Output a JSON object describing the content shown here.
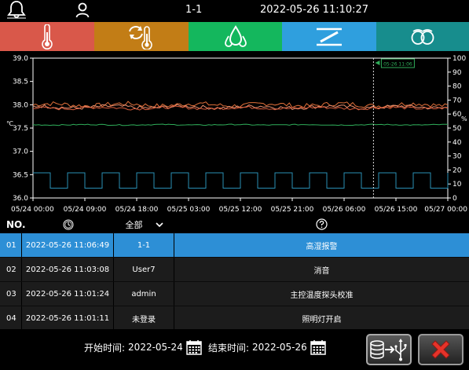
{
  "header": {
    "device_id": "1-1",
    "datetime": "2022-05-26 11:10:27"
  },
  "tabs": [
    {
      "name": "temperature",
      "color": "#d9584a",
      "width": 120
    },
    {
      "name": "temperature-cycle",
      "color": "#c27d16",
      "width": 120
    },
    {
      "name": "humidity",
      "color": "#14b75d",
      "width": 119
    },
    {
      "name": "ventilation",
      "color": "#2f9fde",
      "width": 120
    },
    {
      "name": "egg-turning",
      "color": "#178d8d",
      "width": 118
    }
  ],
  "chart_data": {
    "type": "line",
    "x": [
      "05/24 00:00",
      "05/24 09:00",
      "05/24 18:00",
      "05/25 03:00",
      "05/25 12:00",
      "05/25 21:00",
      "05/26 06:00",
      "05/26 15:00",
      "05/27 00:00"
    ],
    "left_axis": {
      "unit": "℃",
      "ylim": [
        36.0,
        39.0
      ],
      "ticks": [
        "39.0",
        "38.5",
        "38.0",
        "37.5",
        "37.0",
        "36.5",
        "36.0"
      ]
    },
    "right_axis": {
      "unit": "%",
      "ylim": [
        0,
        100
      ],
      "ticks": [
        "100",
        "90",
        "80",
        "70",
        "60",
        "50",
        "40",
        "30",
        "20",
        "10",
        "0"
      ]
    },
    "cursor_label": "05-26 11:06",
    "cursor_x": "05/26 11:06",
    "series": [
      {
        "color": "#e2703a",
        "axis": "left",
        "level": 38.0,
        "noise": 0.05
      },
      {
        "color": "#e89070",
        "axis": "left",
        "level": 37.95,
        "noise": 0.04
      },
      {
        "color": "#d65a3a",
        "axis": "left",
        "level": 37.93,
        "noise": 0.03
      },
      {
        "color": "#2fae5a",
        "axis": "left",
        "level": 37.57,
        "noise": 0.01
      },
      {
        "color": "#2a8fb5",
        "axis": "right",
        "square": {
          "low": 7,
          "high": 18,
          "period_hours": 6
        }
      }
    ],
    "grid": false
  },
  "table": {
    "columns": {
      "no": "NO.",
      "user_filter": "全部"
    },
    "rows": [
      {
        "no": "01",
        "time": "2022-05-26 11:06:49",
        "user": "1-1",
        "message": "高湿报警",
        "selected": true
      },
      {
        "no": "02",
        "time": "2022-05-26 11:03:08",
        "user": "User7",
        "message": "消音"
      },
      {
        "no": "03",
        "time": "2022-05-26 11:01:24",
        "user": "admin",
        "message": "主控温度探头校准"
      },
      {
        "no": "04",
        "time": "2022-05-26 11:01:11",
        "user": "未登录",
        "message": "照明灯开启"
      }
    ]
  },
  "footer": {
    "start_label": "开始时间:",
    "start_value": "2022-05-24",
    "end_label": "结束时间:",
    "end_value": "2022-05-26"
  }
}
